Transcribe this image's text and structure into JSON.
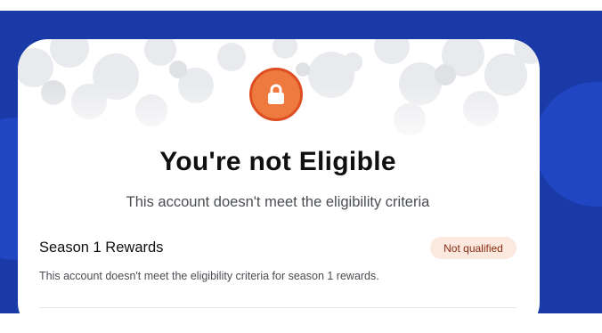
{
  "colors": {
    "backdrop": "#1a3aa8",
    "card": "#ffffff",
    "badge_fill": "#ee7a3f",
    "badge_border": "#dd4e22",
    "status_bg": "#fbe9e0",
    "status_text": "#8a2b12"
  },
  "dialog": {
    "icon": "lock-icon",
    "title": "You're not Eligible",
    "subtitle": "This account doesn't meet the eligibility criteria"
  },
  "rewards": [
    {
      "title": "Season 1 Rewards",
      "status": "Not qualified",
      "description": "This account doesn't meet the eligibility criteria for season 1 rewards."
    }
  ]
}
